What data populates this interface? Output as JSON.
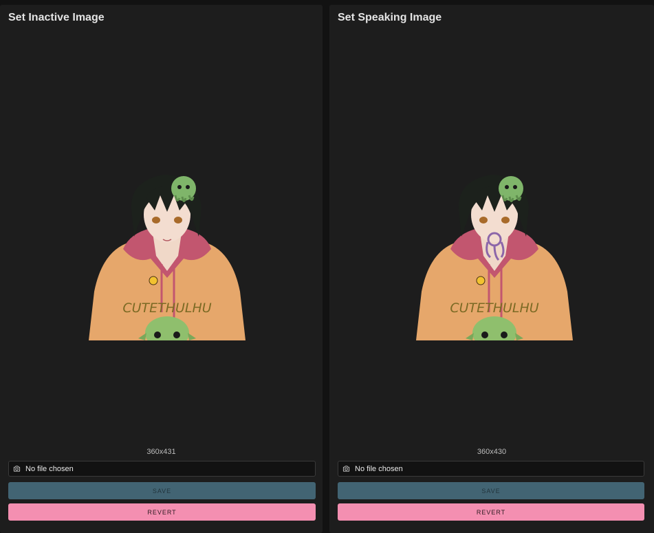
{
  "panels": [
    {
      "title": "Set Inactive Image",
      "dimensions": "360x431",
      "file_status": "No file chosen",
      "save_label": "SAVE",
      "revert_label": "REVERT",
      "shirt_text": "CUTETHULHU",
      "icon": "camera-icon"
    },
    {
      "title": "Set Speaking Image",
      "dimensions": "360x430",
      "file_status": "No file chosen",
      "save_label": "SAVE",
      "revert_label": "REVERT",
      "shirt_text": "CUTETHULHU",
      "icon": "camera-icon"
    }
  ],
  "colors": {
    "panel_bg": "#1d1d1d",
    "save_bg": "#426473",
    "revert_bg": "#f48fb1"
  }
}
